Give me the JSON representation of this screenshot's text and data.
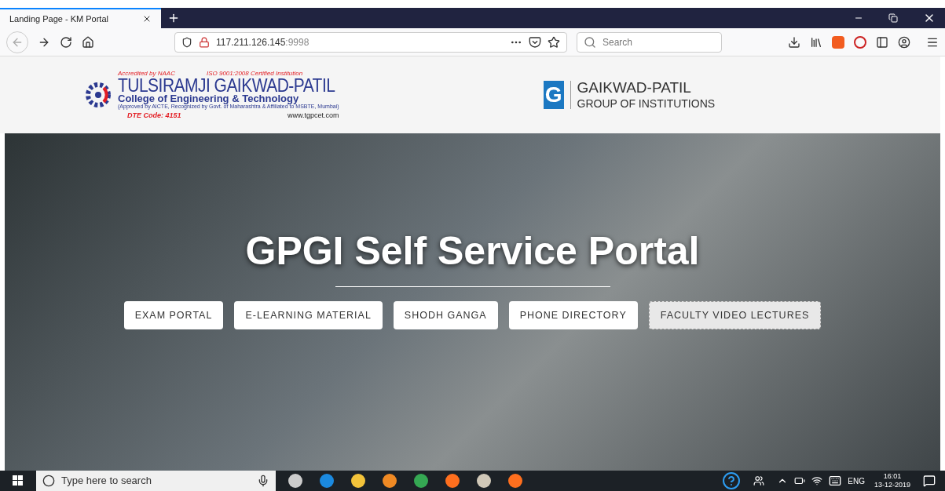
{
  "browser": {
    "tab": {
      "title": "Landing Page - KM Portal",
      "selected": true
    },
    "address": {
      "host": "117.211.126.145",
      "port": ":9998"
    },
    "search": {
      "placeholder": "Search"
    }
  },
  "header": {
    "college": {
      "accreditation": "Accredited by NAAC",
      "iso": "ISO 9001:2008 Certified Institution",
      "name": "TULSIRAMJI GAIKWAD-PATIL",
      "subtitle": "College of Engineering & Technology",
      "approval": "(Approved by AICTE, Recognized by Govt. of Maharashtra & Affiliated to MSBTE, Mumbai)",
      "dte": "DTE Code: 4151",
      "website": "www.tgpcet.com"
    },
    "group": {
      "letter": "G",
      "name": "GAIKWAD-PATIL",
      "subtitle": "GROUP OF INSTITUTIONS"
    }
  },
  "hero": {
    "title": "GPGI Self Service Portal",
    "buttons": [
      {
        "label": "EXAM PORTAL",
        "hovered": false
      },
      {
        "label": "E-LEARNING MATERIAL",
        "hovered": false
      },
      {
        "label": "SHODH GANGA",
        "hovered": false
      },
      {
        "label": "PHONE DIRECTORY",
        "hovered": false
      },
      {
        "label": "FACULTY VIDEO LECTURES",
        "hovered": true
      }
    ]
  },
  "taskbar": {
    "search_placeholder": "Type here to search",
    "language": "ENG",
    "time": "16:01",
    "date": "13-12-2019"
  }
}
